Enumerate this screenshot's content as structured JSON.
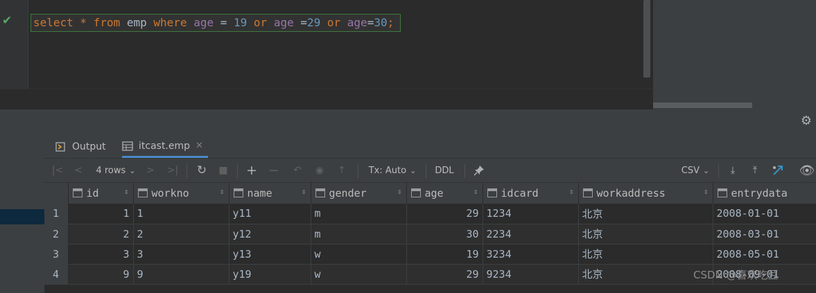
{
  "editor": {
    "tokens": [
      {
        "t": "select",
        "c": "kw"
      },
      {
        "t": " * ",
        "c": "kw"
      },
      {
        "t": "from",
        "c": "kw"
      },
      {
        "t": " emp ",
        "c": "id"
      },
      {
        "t": "where",
        "c": "kw"
      },
      {
        "t": " age",
        "c": "fld"
      },
      {
        "t": " = ",
        "c": "id"
      },
      {
        "t": "19",
        "c": "num"
      },
      {
        "t": " or",
        "c": "kw"
      },
      {
        "t": " age",
        "c": "fld"
      },
      {
        "t": " =",
        "c": "id"
      },
      {
        "t": "29",
        "c": "num"
      },
      {
        "t": " or",
        "c": "kw"
      },
      {
        "t": " age",
        "c": "fld"
      },
      {
        "t": "=",
        "c": "id"
      },
      {
        "t": "30",
        "c": "num"
      },
      {
        "t": ";",
        "c": "kw"
      }
    ]
  },
  "tabs": {
    "output": "Output",
    "table": "itcast.emp"
  },
  "toolbar": {
    "rows_label": "4 rows",
    "tx_label": "Tx: Auto",
    "ddl_label": "DDL",
    "csv_label": "CSV"
  },
  "grid": {
    "columns": [
      "id",
      "workno",
      "name",
      "gender",
      "age",
      "idcard",
      "workaddress",
      "entrydata"
    ],
    "rows": [
      {
        "num": "1",
        "id": "1",
        "workno": "1",
        "name": "y11",
        "gender": "m",
        "age": "29",
        "idcard": "1234",
        "workaddress": "北京",
        "entrydata": "2008-01-01"
      },
      {
        "num": "2",
        "id": "2",
        "workno": "2",
        "name": "y12",
        "gender": "m",
        "age": "30",
        "idcard": "2234",
        "workaddress": "北京",
        "entrydata": "2008-03-01"
      },
      {
        "num": "3",
        "id": "3",
        "workno": "3",
        "name": "y13",
        "gender": "w",
        "age": "19",
        "idcard": "3234",
        "workaddress": "北京",
        "entrydata": "2008-05-01"
      },
      {
        "num": "4",
        "id": "9",
        "workno": "9",
        "name": "y19",
        "gender": "w",
        "age": "29",
        "idcard": "9234",
        "workaddress": "北京",
        "entrydata": "2008-09-01"
      }
    ]
  },
  "watermark": "CSDN @喜欢吃豆"
}
